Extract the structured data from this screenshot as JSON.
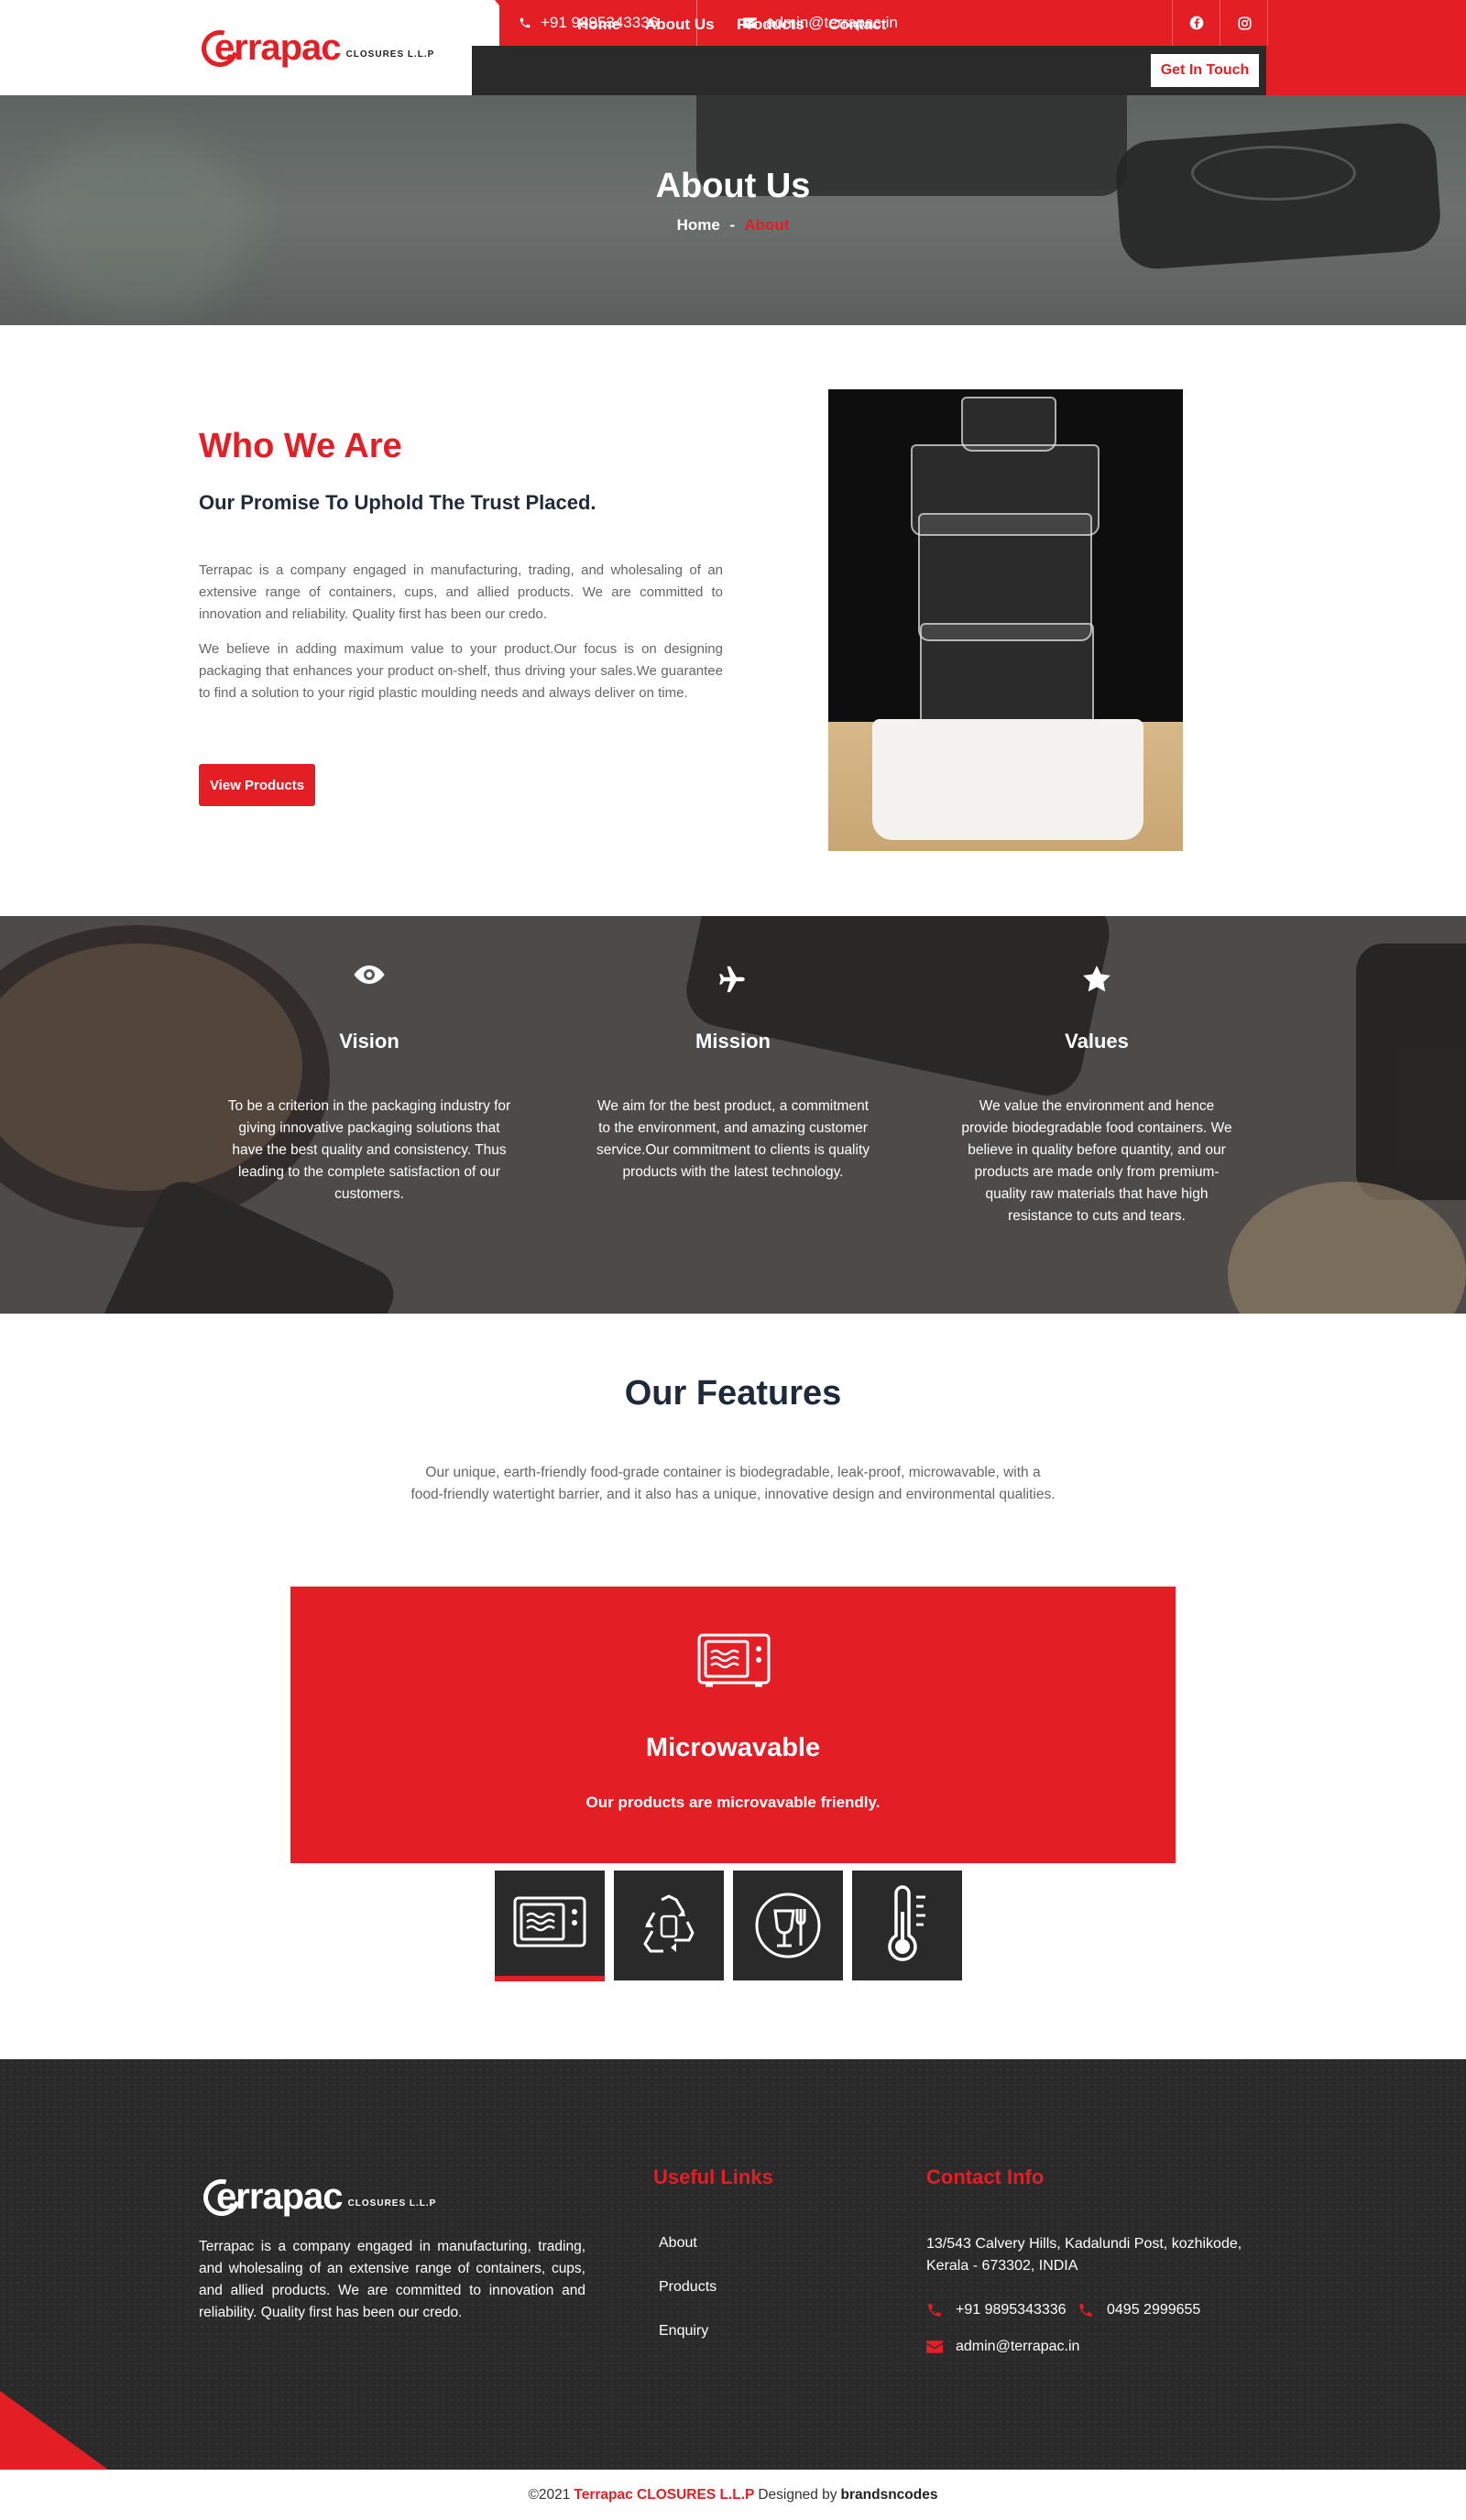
{
  "header": {
    "logo_text": "errapac",
    "logo_sub": "CLOSURES L.L.P",
    "phone": "+91 9895343336",
    "email": "admin@terrapac.in",
    "nav": [
      "Home",
      "About Us",
      "Products",
      "Contact"
    ],
    "cta": "Get In Touch"
  },
  "hero": {
    "title": "About Us",
    "crumb_home": "Home",
    "crumb_sep": "-",
    "crumb_current": "About"
  },
  "who": {
    "title": "Who We Are",
    "subtitle": "Our Promise To Uphold The Trust Placed.",
    "p1": "Terrapac is a company engaged in manufacturing, trading, and wholesaling of an extensive range of containers, cups, and allied products. We are committed to innovation and reliability. Quality first has been our credo.",
    "p2": "We believe in adding maximum value to your product.Our focus is on designing packaging that enhances your product on-shelf, thus driving your sales.We guarantee to find a solution to your rigid plastic moulding needs and always deliver on time.",
    "button": "View Products"
  },
  "vmv": [
    {
      "icon": "eye-icon",
      "title": "Vision",
      "text": "To be a criterion in the packaging industry for giving innovative packaging solutions that have the best quality and consistency. Thus leading to the complete satisfaction of our customers."
    },
    {
      "icon": "plane-icon",
      "title": "Mission",
      "text": "We aim for the best product, a commitment to the environment, and amazing customer service.Our commitment to clients is quality products with the latest technology."
    },
    {
      "icon": "star-icon",
      "title": "Values",
      "text": "We value the environment and hence provide biodegradable food containers. We believe in quality before quantity, and our products are made only from premium-quality raw materials that have high resistance to cuts and tears."
    }
  ],
  "features": {
    "title": "Our Features",
    "description": "Our unique, earth-friendly food-grade container is biodegradable, leak-proof, microwavable, with a food-friendly watertight barrier, and it also has a unique, innovative design and environmental qualities.",
    "active": {
      "title": "Microwavable",
      "text": "Our products are microvavable friendly."
    },
    "tabs": [
      "microwave-icon",
      "recycle-icon",
      "food-safe-icon",
      "thermometer-icon"
    ]
  },
  "footer": {
    "about": "Terrapac is a company engaged in manufacturing, trading, and wholesaling of an extensive range of containers, cups, and allied products. We are committed to innovation and reliability. Quality first has been our credo.",
    "links_title": "Useful Links",
    "links": [
      "About",
      "Products",
      "Enquiry"
    ],
    "contact_title": "Contact Info",
    "address": "13/543 Calvery Hills, Kadalundi Post, kozhikode, Kerala - 673302, INDIA",
    "phone1": "+91 9895343336",
    "phone2": "0495 2999655",
    "email": "admin@terrapac.in"
  },
  "copyright": {
    "prefix": "©2021",
    "brand": "Terrapac CLOSURES L.L.P",
    "designed": "Designed by",
    "designer": "brandsncodes"
  },
  "colors": {
    "accent": "#e31e24",
    "dark": "#2a2a2a"
  }
}
